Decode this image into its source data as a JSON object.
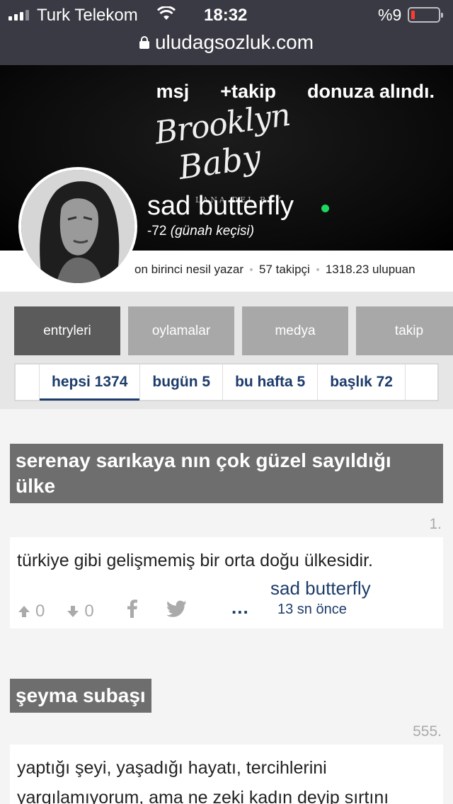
{
  "status_bar": {
    "carrier": "Turk Telekom",
    "time": "18:32",
    "battery_percent": "%9",
    "battery_level": 0.09,
    "battery_color": "#ff3b30"
  },
  "browser": {
    "url": "uludagsozluk.com"
  },
  "cover": {
    "nav": {
      "message": "msj",
      "follow": "+takip",
      "status": "donuza alındı."
    },
    "art_line1": "Brooklyn",
    "art_line2": "Baby",
    "art_line3": "LANA DEL REY"
  },
  "profile": {
    "name": "sad butterfly",
    "online": true,
    "online_color": "#1ed760",
    "karma_value": "-72",
    "karma_label": "(günah keçisi)",
    "generation": "on birinci nesil yazar",
    "followers": "57 takipçi",
    "points": "1318.23 ulupuan"
  },
  "tabs": [
    {
      "label": "entryleri",
      "active": true
    },
    {
      "label": "oylamalar",
      "active": false
    },
    {
      "label": "medya",
      "active": false
    },
    {
      "label": "takip",
      "active": false
    }
  ],
  "subtabs": [
    {
      "label": "hepsi 1374",
      "active": true
    },
    {
      "label": "bugün 5",
      "active": false
    },
    {
      "label": "bu hafta 5",
      "active": false
    },
    {
      "label": "başlık 72",
      "active": false
    }
  ],
  "entries": [
    {
      "title_line1": "serenay sarıkaya nın çok güzel sayıldığı",
      "title_line2": "ülke",
      "number": "1.",
      "text": "türkiye gibi gelişmemiş bir orta doğu ülkesidir.",
      "upvotes": "0",
      "downvotes": "0",
      "more": "...",
      "author": "sad butterfly",
      "ago": "13 sn önce"
    },
    {
      "title_line1": "şeyma subaşı",
      "number": "555.",
      "text_line1": "yaptığı şeyi, yaşadığı hayatı, tercihlerini",
      "text_line2": "yargılamıyorum, ama ne zeki kadın deyip sırtını"
    }
  ],
  "colors": {
    "link_blue": "#1d3c6a",
    "active_tab": "#5b5b5b",
    "inactive_tab": "#a8a8a8",
    "title_bg": "#6e6e6e"
  }
}
